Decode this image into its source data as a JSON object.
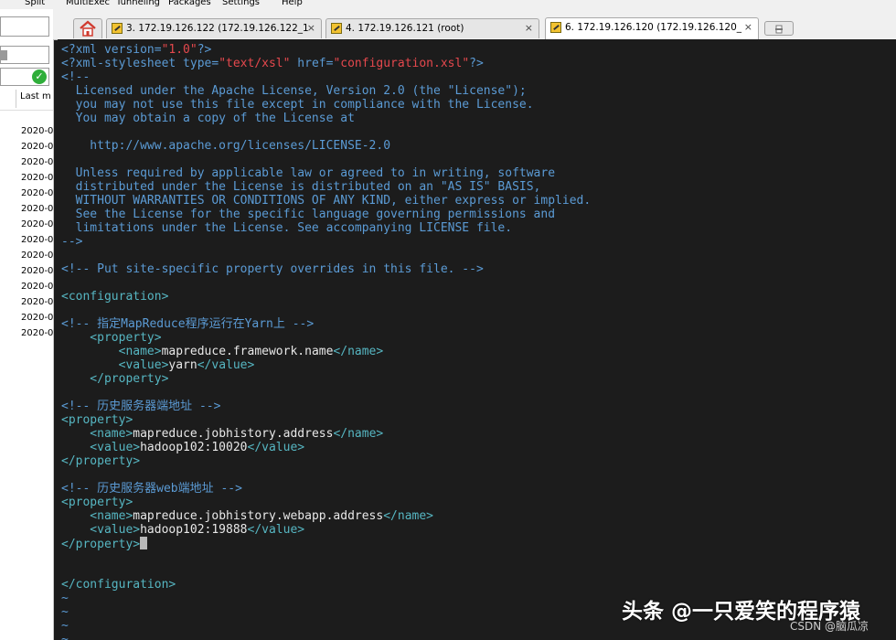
{
  "menu": [
    "Split",
    "MultiExec",
    "Tunneling",
    "Packages",
    "Settings",
    "Help"
  ],
  "sidebar": {
    "column_header": "Last m",
    "dates": [
      "2020-0",
      "2020-0",
      "2020-0",
      "2020-0",
      "2020-0",
      "2020-0",
      "2020-0",
      "2020-0",
      "2020-0",
      "2020-0",
      "2020-0",
      "2020-0",
      "2020-0",
      "2020-0"
    ]
  },
  "tabs": [
    {
      "label": "3. 172.19.126.122 (172.19.126.122_1",
      "close": "×"
    },
    {
      "label": "4. 172.19.126.121 (root)",
      "close": "×"
    },
    {
      "label": "6. 172.19.126.120 (172.19.126.120_",
      "close": "×"
    }
  ],
  "terminal": {
    "lines": [
      {
        "parts": [
          {
            "c": "c",
            "t": "<?xml version="
          },
          {
            "c": "s",
            "t": "\"1.0\""
          },
          {
            "c": "c",
            "t": "?>"
          }
        ]
      },
      {
        "parts": [
          {
            "c": "c",
            "t": "<?xml-stylesheet type="
          },
          {
            "c": "s",
            "t": "\"text/xsl\""
          },
          {
            "c": "c",
            "t": " href="
          },
          {
            "c": "s",
            "t": "\"configuration.xsl\""
          },
          {
            "c": "c",
            "t": "?>"
          }
        ]
      },
      {
        "parts": [
          {
            "c": "c",
            "t": "<!--"
          }
        ]
      },
      {
        "parts": [
          {
            "c": "c",
            "t": "  Licensed under the Apache License, Version 2.0 (the \"License\");"
          }
        ]
      },
      {
        "parts": [
          {
            "c": "c",
            "t": "  you may not use this file except in compliance with the License."
          }
        ]
      },
      {
        "parts": [
          {
            "c": "c",
            "t": "  You may obtain a copy of the License at"
          }
        ]
      },
      {
        "parts": []
      },
      {
        "parts": [
          {
            "c": "c",
            "t": "    http://www.apache.org/licenses/LICENSE-2.0"
          }
        ]
      },
      {
        "parts": []
      },
      {
        "parts": [
          {
            "c": "c",
            "t": "  Unless required by applicable law or agreed to in writing, software"
          }
        ]
      },
      {
        "parts": [
          {
            "c": "c",
            "t": "  distributed under the License is distributed on an \"AS IS\" BASIS,"
          }
        ]
      },
      {
        "parts": [
          {
            "c": "c",
            "t": "  WITHOUT WARRANTIES OR CONDITIONS OF ANY KIND, either express or implied."
          }
        ]
      },
      {
        "parts": [
          {
            "c": "c",
            "t": "  See the License for the specific language governing permissions and"
          }
        ]
      },
      {
        "parts": [
          {
            "c": "c",
            "t": "  limitations under the License. See accompanying LICENSE file."
          }
        ]
      },
      {
        "parts": [
          {
            "c": "c",
            "t": "-->"
          }
        ]
      },
      {
        "parts": []
      },
      {
        "parts": [
          {
            "c": "c",
            "t": "<!-- Put site-specific property overrides in this file. -->"
          }
        ]
      },
      {
        "parts": []
      },
      {
        "parts": [
          {
            "c": "t",
            "t": "<configuration>"
          }
        ]
      },
      {
        "parts": []
      },
      {
        "parts": [
          {
            "c": "c",
            "t": "<!-- 指定MapReduce程序运行在Yarn上 -->"
          }
        ]
      },
      {
        "parts": [
          {
            "c": "t",
            "t": "    <property>"
          }
        ]
      },
      {
        "parts": [
          {
            "c": "t",
            "t": "        <name>"
          },
          {
            "c": "w",
            "t": "mapreduce.framework.name"
          },
          {
            "c": "t",
            "t": "</name>"
          }
        ]
      },
      {
        "parts": [
          {
            "c": "t",
            "t": "        <value>"
          },
          {
            "c": "w",
            "t": "yarn"
          },
          {
            "c": "t",
            "t": "</value>"
          }
        ]
      },
      {
        "parts": [
          {
            "c": "t",
            "t": "    </property>"
          }
        ]
      },
      {
        "parts": []
      },
      {
        "parts": [
          {
            "c": "c",
            "t": "<!-- 历史服务器端地址 -->"
          }
        ]
      },
      {
        "parts": [
          {
            "c": "t",
            "t": "<property>"
          }
        ]
      },
      {
        "parts": [
          {
            "c": "t",
            "t": "    <name>"
          },
          {
            "c": "w",
            "t": "mapreduce.jobhistory.address"
          },
          {
            "c": "t",
            "t": "</name>"
          }
        ]
      },
      {
        "parts": [
          {
            "c": "t",
            "t": "    <value>"
          },
          {
            "c": "w",
            "t": "hadoop102:10020"
          },
          {
            "c": "t",
            "t": "</value>"
          }
        ]
      },
      {
        "parts": [
          {
            "c": "t",
            "t": "</property>"
          }
        ]
      },
      {
        "parts": []
      },
      {
        "parts": [
          {
            "c": "c",
            "t": "<!-- 历史服务器web端地址 -->"
          }
        ]
      },
      {
        "parts": [
          {
            "c": "t",
            "t": "<property>"
          }
        ]
      },
      {
        "parts": [
          {
            "c": "t",
            "t": "    <name>"
          },
          {
            "c": "w",
            "t": "mapreduce.jobhistory.webapp.address"
          },
          {
            "c": "t",
            "t": "</name>"
          }
        ]
      },
      {
        "parts": [
          {
            "c": "t",
            "t": "    <value>"
          },
          {
            "c": "w",
            "t": "hadoop102:19888"
          },
          {
            "c": "t",
            "t": "</value>"
          }
        ]
      },
      {
        "parts": [
          {
            "c": "t",
            "t": "</property>"
          }
        ],
        "cursor": true
      },
      {
        "parts": []
      },
      {
        "parts": []
      },
      {
        "parts": [
          {
            "c": "t",
            "t": "</configuration>"
          }
        ]
      },
      {
        "parts": [
          {
            "c": "c",
            "t": "~"
          }
        ]
      },
      {
        "parts": [
          {
            "c": "c",
            "t": "~"
          }
        ]
      },
      {
        "parts": [
          {
            "c": "c",
            "t": "~"
          }
        ]
      },
      {
        "parts": [
          {
            "c": "c",
            "t": "~"
          }
        ]
      }
    ]
  },
  "watermark": {
    "main": "头条 @一只爱笑的程序猿",
    "sub": "CSDN @脑瓜凉"
  },
  "colors": {
    "background": "#1c1c1c",
    "comment": "#5b9bd5",
    "tag": "#56b6c2",
    "string": "#e5484d",
    "text": "#e8e8e8"
  }
}
